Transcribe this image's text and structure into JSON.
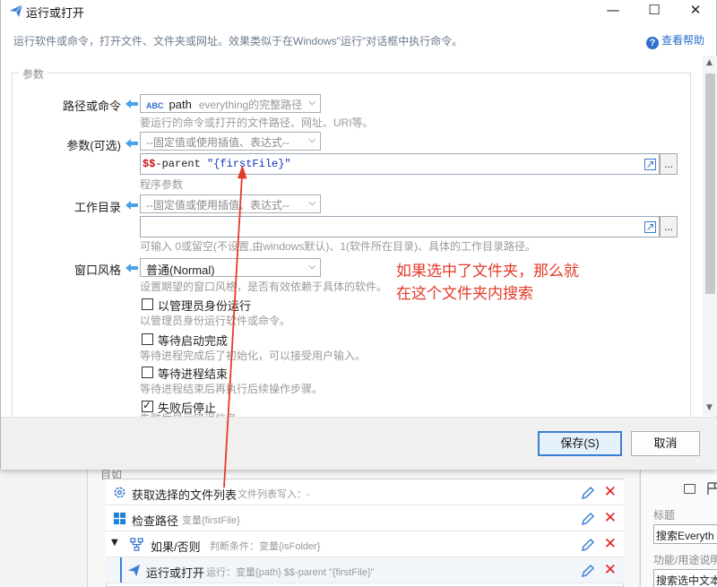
{
  "dialog": {
    "title": "运行或打开",
    "description": "运行软件或命令，打开文件、文件夹或网址。效果类似于在Windows\"运行\"对话框中执行命令。",
    "help_label": "查看帮助",
    "group_title": "参数",
    "fields": {
      "path": {
        "label": "路径或命令",
        "select_abc": "ABC",
        "select_main": "path",
        "select_sub": "everything的完整路径",
        "hint": "要运行的命令或打开的文件路径、网址、URI等。"
      },
      "args": {
        "label": "参数(可选)",
        "select_placeholder": "--固定值或使用插值、表达式--",
        "value_prefix": "$$",
        "value_keyword": "-parent ",
        "value_string": "\"{firstFile}\"",
        "hint": "程序参数",
        "dots": "..."
      },
      "workdir": {
        "label": "工作目录",
        "select_placeholder": "--固定值或使用插值、表达式--",
        "value": "",
        "hint": "可输入 0或留空(不设置,由windows默认)、1(软件所在目录)、具体的工作目录路径。",
        "dots": "..."
      },
      "window_style": {
        "label": "窗口风格",
        "selected": "普通(Normal)",
        "hint": "设置期望的窗口风格，是否有效依赖于具体的软件。"
      }
    },
    "checkboxes": [
      {
        "label": "以管理员身份运行",
        "hint": "以管理员身份运行软件或命令。",
        "checked": false
      },
      {
        "label": "等待启动完成",
        "hint": "等待进程完成后了初始化，可以接受用户输入。",
        "checked": false
      },
      {
        "label": "等待进程结束",
        "hint": "等待进程结束后再执行后续操作步骤。",
        "checked": false
      },
      {
        "label": "失败后停止",
        "hint": "失败后显示错误信息。",
        "checked": true
      }
    ],
    "annotation": [
      "如果选中了文件夹，那么就",
      "在这个文件夹内搜索"
    ],
    "save_label": "保存(S)",
    "cancel_label": "取消"
  },
  "background": {
    "panel_title": "目如",
    "steps": [
      {
        "title": "获取选择的文件列表",
        "desc": "文件列表写入：-",
        "icon": "gear-icon"
      },
      {
        "title": "检查路径",
        "desc": "变量{firstFile}",
        "icon": "windows-icon"
      },
      {
        "title": "如果/否则",
        "desc": "判断条件：变量{isFolder}",
        "icon": "branch-icon"
      },
      {
        "title": "运行或打开",
        "desc": "运行：变量{path} $$-parent \"{firstFile}\"",
        "icon": "send-icon"
      }
    ],
    "right_panel": {
      "title_label": "标题",
      "title_value": "搜索Everyth",
      "purpose_label": "功能/用途说明",
      "purpose_value": "搜索选中文本"
    }
  },
  "colors": {
    "accent": "#2f6fcf",
    "annotation": "#e33a2a",
    "delete": "#e02020"
  }
}
